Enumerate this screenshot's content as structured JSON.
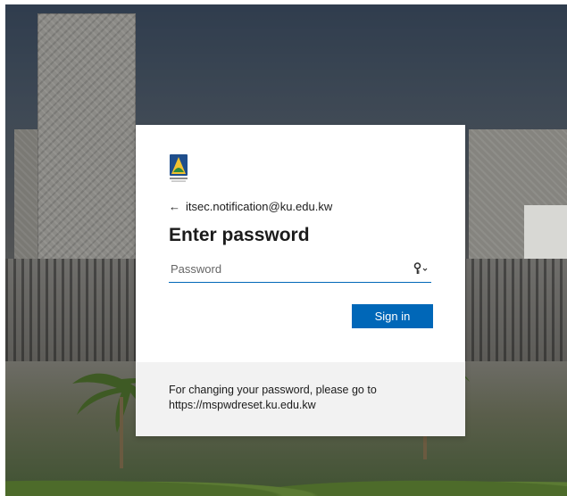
{
  "login": {
    "identity_email": "itsec.notification@ku.edu.kw",
    "back_arrow": "←",
    "heading": "Enter password",
    "password_placeholder": "Password",
    "password_value": "",
    "signin_label": "Sign in",
    "footer_line1": "For changing your password, please go to",
    "footer_line2": "https://mspwdreset.ku.edu.kw"
  },
  "icons": {
    "logo": "university-logo",
    "key": "key-icon",
    "dropdown": "chevron-down-icon",
    "back": "arrow-left-icon"
  },
  "colors": {
    "accent": "#0067b8",
    "footer_bg": "#f2f2f2",
    "text": "#1b1b1b"
  }
}
